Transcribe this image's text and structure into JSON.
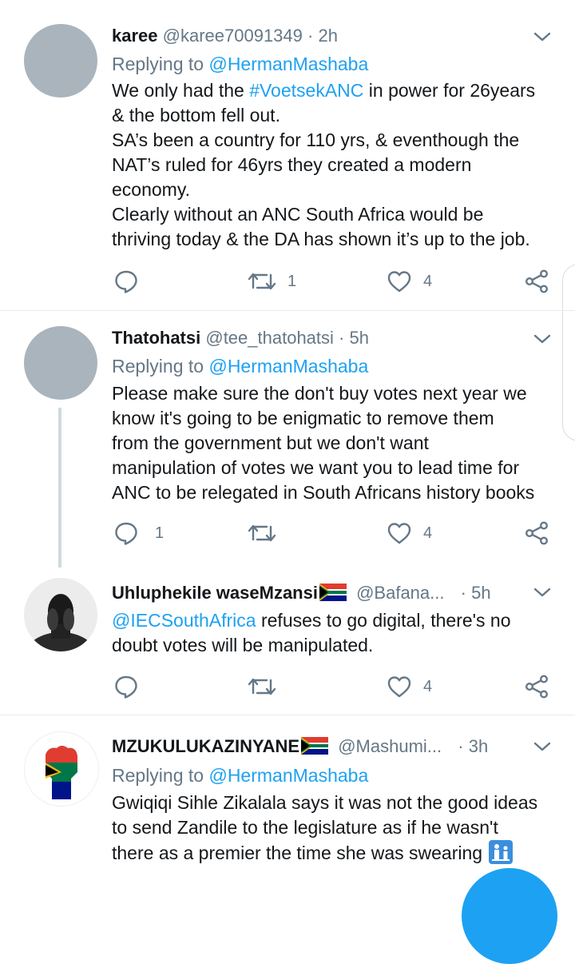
{
  "tweets": [
    {
      "name": "karee",
      "handle": "@karee70091349",
      "sep": "·",
      "time": "2h",
      "replying_prefix": "Replying to ",
      "replying_to": "@HermanMashaba",
      "body_lines": [
        {
          "pre": "We only had the ",
          "link": "#VoetsekANC",
          "post": " in power for 26years"
        },
        {
          "text": "& the bottom fell out."
        },
        {
          "text": "SA’s been a country for 110 yrs, & eventhough the"
        },
        {
          "text": "NAT’s ruled for 46yrs they created a modern"
        },
        {
          "text": "economy."
        },
        {
          "text": "Clearly without an ANC South Africa would be"
        },
        {
          "text": "thriving today & the DA has shown it’s up to the job."
        }
      ],
      "replies": "",
      "retweets": "1",
      "likes": "4"
    },
    {
      "name": "Thatohatsi",
      "handle": "@tee_thatohatsi",
      "sep": "·",
      "time": "5h",
      "replying_prefix": "Replying to ",
      "replying_to": "@HermanMashaba",
      "body_lines": [
        {
          "text": "Please make sure the don't buy votes next year we"
        },
        {
          "text": "know it's going to be enigmatic to remove them"
        },
        {
          "text": "from the government but we don't want"
        },
        {
          "text": "manipulation of votes we want you to lead time for"
        },
        {
          "text": "ANC to be relegated in South Africans history books"
        }
      ],
      "replies": "1",
      "retweets": "",
      "likes": "4"
    },
    {
      "name": "Uhluphekile waseMzansi",
      "handle": "@Bafana...",
      "sep": "·",
      "time": "5h",
      "body_lines": [
        {
          "link": "@IECSouthAfrica",
          "post": " refuses to go digital, there's no"
        },
        {
          "text": "doubt votes will be manipulated."
        }
      ],
      "replies": "",
      "retweets": "",
      "likes": "4"
    },
    {
      "name": "MZUKULUKAZINYANE",
      "handle": "@Mashumi...",
      "sep": "·",
      "time": "3h",
      "replying_prefix": "Replying to ",
      "replying_to": "@HermanMashaba",
      "body_lines": [
        {
          "text": "Gwiqiqi Sihle Zikalala says it was not the good ideas"
        },
        {
          "text": "to send Zandile to the legislature as if he wasn't"
        },
        {
          "text": "there as a premier the time she was swearing"
        }
      ]
    }
  ],
  "icons": {
    "reply": "reply-icon",
    "retweet": "retweet-icon",
    "like": "heart-icon",
    "share": "share-icon",
    "more": "chevron-down-icon",
    "flag": "south-africa-flag-icon"
  },
  "colors": {
    "link": "#1da1f2",
    "secondary_text": "#657786",
    "divider": "#e6ecf0",
    "avatar_placeholder": "#a9b4bd"
  }
}
